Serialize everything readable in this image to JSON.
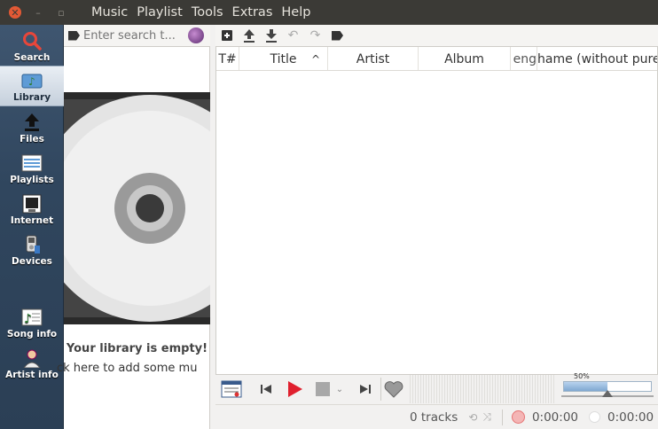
{
  "menubar": {
    "items": [
      "Music",
      "Playlist",
      "Tools",
      "Extras",
      "Help"
    ]
  },
  "sidebar": {
    "items": [
      {
        "label": "Search",
        "icon": "search-icon"
      },
      {
        "label": "Library",
        "icon": "library-icon"
      },
      {
        "label": "Files",
        "icon": "files-icon"
      },
      {
        "label": "Playlists",
        "icon": "playlists-icon"
      },
      {
        "label": "Internet",
        "icon": "internet-icon"
      },
      {
        "label": "Devices",
        "icon": "devices-icon"
      },
      {
        "label": "Song info",
        "icon": "song-info-icon"
      },
      {
        "label": "Artist info",
        "icon": "artist-info-icon"
      }
    ],
    "active": "Library"
  },
  "library": {
    "search_placeholder": "Enter search t...",
    "empty_title": "Your library is empty!",
    "empty_sub": "ck here to add some mu"
  },
  "playlist": {
    "columns": [
      "T#",
      "Title",
      "Artist",
      "Album",
      "eng",
      "hame (without pure"
    ],
    "sort_indicator": "^"
  },
  "player": {
    "volume_label": "50%",
    "volume_level": 0.5
  },
  "status": {
    "tracks": "0 tracks",
    "elapsed": "0:00:00",
    "total": "0:00:00"
  },
  "colors": {
    "play_accent": "#e0202e",
    "close_button": "#e35935",
    "sidebar_bg": "#344b63"
  }
}
